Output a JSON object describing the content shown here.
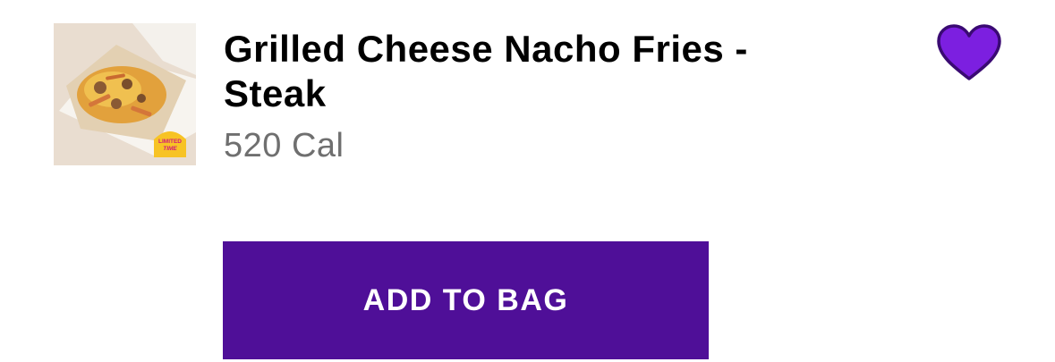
{
  "product": {
    "name": "Grilled Cheese Nacho Fries - Steak",
    "calories": "520 Cal",
    "badge": "LIMITED TIME",
    "favorite_icon": "heart-icon"
  },
  "actions": {
    "add_to_bag_label": "ADD TO BAG"
  },
  "colors": {
    "brand_purple": "#4f0f98",
    "heart_fill": "#7c1fe0",
    "heart_stroke": "#3a0a73",
    "calorie_text": "#6f6f6f",
    "badge_yellow": "#f7c325",
    "badge_text": "#d0197a"
  }
}
